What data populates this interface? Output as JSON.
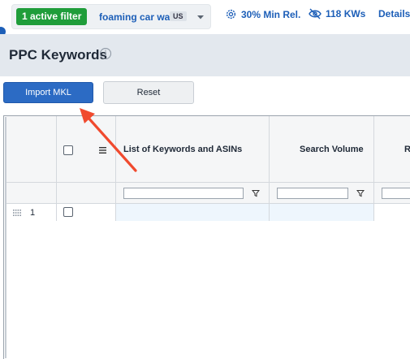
{
  "topbar": {
    "active_filter": "1 active filter",
    "keyword": "foaming car wash",
    "country": "US",
    "min_rel": "30% Min Rel.",
    "kws": "118 KWs",
    "details": "Details"
  },
  "page": {
    "title": "PPC Keywords"
  },
  "toolbar": {
    "import_label": "Import MKL",
    "reset_label": "Reset"
  },
  "grid": {
    "columns": [
      "List of Keywords and ASINs",
      "Search Volume",
      "R"
    ],
    "rows": [
      {
        "number": "1",
        "checked": false
      }
    ]
  },
  "colors": {
    "accent": "#2c6bc4",
    "active_filter_bg": "#1f9d3a",
    "link": "#1d5fb8",
    "annotation_arrow": "#f04a2e"
  }
}
